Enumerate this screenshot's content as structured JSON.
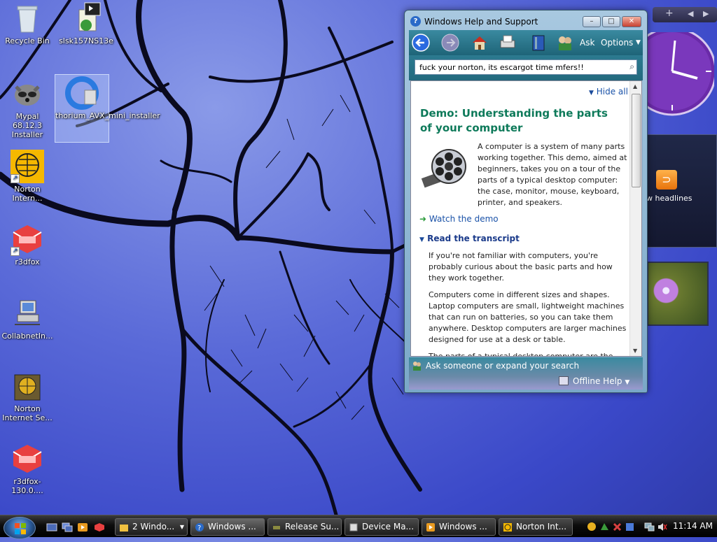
{
  "desktop_icons": [
    {
      "label": "Recycle Bin",
      "icon": "recycle-bin-icon"
    },
    {
      "label": "slsk157NS13e",
      "icon": "installer-icon"
    },
    {
      "label": "Mypal 68.12.3 Installer",
      "icon": "raccoon-icon"
    },
    {
      "label": "thorium_AVX_mini_installer",
      "icon": "thorium-icon"
    },
    {
      "label": "Norton Intern...",
      "icon": "norton-globe-icon"
    },
    {
      "label": "r3dfox",
      "icon": "r3dfox-icon"
    },
    {
      "label": "CollabnetIn...",
      "icon": "computer-network-icon"
    },
    {
      "label": "Norton Internet Se...",
      "icon": "norton-box-icon"
    },
    {
      "label": "r3dfox-130.0....",
      "icon": "r3dfox-icon"
    }
  ],
  "help_window": {
    "title": "Windows Help and Support",
    "controls": {
      "minimize": "–",
      "maximize": "□",
      "close": "✕"
    },
    "toolbar": {
      "ask_label": "Ask",
      "options_label": "Options"
    },
    "search_value": "fuck your norton, its escargot time mfers!!",
    "content": {
      "hide_all": "Hide all",
      "title": "Demo: Understanding the parts of your computer",
      "intro": "A computer is a system of many parts working together. This demo, aimed at beginners, takes you on a tour of the parts of a typical desktop computer: the case, monitor, mouse, keyboard, printer, and speakers.",
      "watch_link": "Watch the demo",
      "transcript_heading": "Read the transcript",
      "p1": "If you're not familiar with computers, you're probably curious about the basic parts and how they work together.",
      "p2": "Computers come in different sizes and shapes. Laptop computers are small, lightweight machines that can run on batteries, so you can take them anywhere. Desktop computers are larger machines designed for use at a desk or table.",
      "p3": "The parts of a typical desktop computer are the case"
    },
    "bottom": {
      "ask_text": "Ask someone or expand your search",
      "offline": "Offline Help"
    }
  },
  "sidebar": {
    "add_gadget": "+",
    "feed_text": "w headlines"
  },
  "taskbar": {
    "buttons": [
      {
        "label": "2 Windo...",
        "icon": "folder-icon"
      },
      {
        "label": "Windows ...",
        "icon": "help-icon"
      },
      {
        "label": "Release Su...",
        "icon": "tool-icon"
      },
      {
        "label": "Device Ma...",
        "icon": "device-manager-icon"
      },
      {
        "label": "Windows ...",
        "icon": "media-player-icon"
      },
      {
        "label": "Norton Int...",
        "icon": "norton-icon"
      }
    ],
    "clock": "11:14 AM"
  }
}
